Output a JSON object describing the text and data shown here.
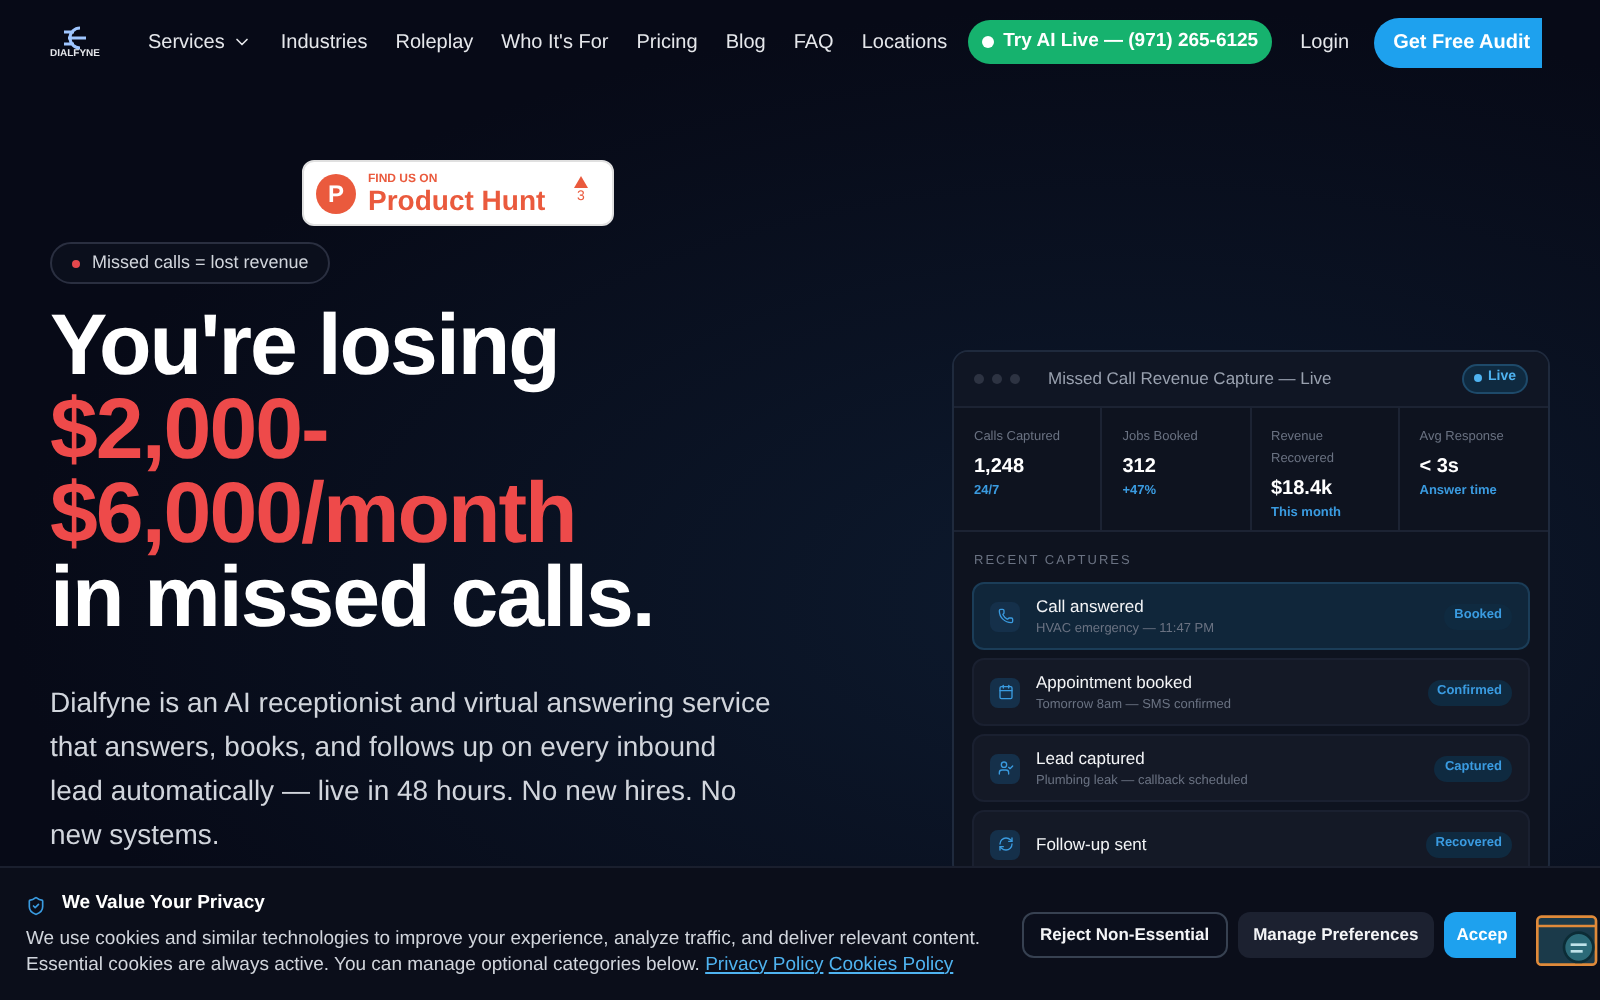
{
  "nav": {
    "logo": "DIALFYNE",
    "items": [
      {
        "label": "Services",
        "dropdown": true
      },
      {
        "label": "Industries",
        "dropdown": false
      },
      {
        "label": "Roleplay",
        "dropdown": false
      },
      {
        "label": "Who It's For",
        "dropdown": false
      },
      {
        "label": "Pricing",
        "dropdown": false
      },
      {
        "label": "Blog",
        "dropdown": false
      },
      {
        "label": "FAQ",
        "dropdown": false
      },
      {
        "label": "Locations",
        "dropdown": false
      }
    ],
    "cta_live": "Try AI Live — (971) 265-6125",
    "login": "Login",
    "cta_audit": "Get Free Audit"
  },
  "product_hunt": {
    "eyebrow": "FIND US ON",
    "name": "Product Hunt",
    "letter": "P",
    "count": "3"
  },
  "hero": {
    "badge": "Missed calls = lost revenue",
    "title_lines": [
      {
        "text": "You're losing",
        "accent": false
      },
      {
        "text": "$2,000-",
        "accent": true
      },
      {
        "text": "$6,000/month",
        "accent": true
      },
      {
        "text": "in missed calls.",
        "accent": false
      }
    ],
    "description": "Dialfyne is an AI receptionist and virtual answering service that answers, books, and follows up on every inbound lead automatically — live in 48 hours. No new hires. No new systems."
  },
  "dashboard": {
    "title": "Missed Call Revenue Capture — Live",
    "status": "Live",
    "stats": [
      {
        "label": "Calls Captured",
        "value": "1,248",
        "note": "24/7"
      },
      {
        "label": "Jobs Booked",
        "value": "312",
        "note": "+47%"
      },
      {
        "label": "Revenue Recovered",
        "value": "$18.4k",
        "note": "This month"
      },
      {
        "label": "Avg Response",
        "value": "< 3s",
        "note": "Answer time"
      }
    ],
    "section": "RECENT CAPTURES",
    "captures": [
      {
        "kind": "phone",
        "title": "Call answered",
        "detail": "HVAC emergency — 11:47 PM",
        "tag": "Booked",
        "selected": true
      },
      {
        "kind": "calendar",
        "title": "Appointment booked",
        "detail": "Tomorrow 8am — SMS confirmed",
        "tag": "Confirmed",
        "selected": false
      },
      {
        "kind": "user",
        "title": "Lead captured",
        "detail": "Plumbing leak — callback scheduled",
        "tag": "Captured",
        "selected": false
      },
      {
        "kind": "refresh",
        "title": "Follow-up sent",
        "tag": "Recovered",
        "selected": false
      }
    ]
  },
  "cookie": {
    "title": "We Value Your Privacy",
    "text": "We use cookies and similar technologies to improve your experience, analyze traffic, and deliver relevant content. Essential cookies are always active. You can manage optional categories below.",
    "links": [
      "Privacy Policy",
      "Cookies Policy"
    ],
    "buttons": [
      {
        "label": "Reject Non-Essential",
        "kind": "outline"
      },
      {
        "label": "Manage Preferences",
        "kind": "muted"
      },
      {
        "label": "Accep",
        "kind": "primary"
      }
    ]
  }
}
